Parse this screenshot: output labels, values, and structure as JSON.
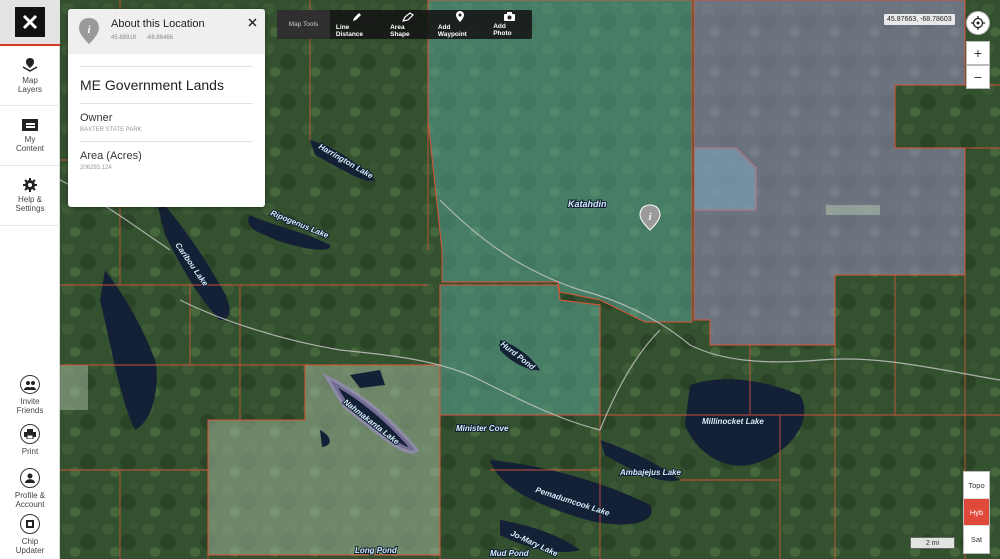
{
  "sidebar": {
    "items": [
      {
        "label": "Map\nLayers",
        "icon": "map-layers-icon"
      },
      {
        "label": "My\nContent",
        "icon": "folder-icon"
      },
      {
        "label": "Help &\nSettings",
        "icon": "gear-icon"
      }
    ],
    "bottom_items": [
      {
        "label": "Invite\nFriends",
        "icon": "invite-friends-icon"
      },
      {
        "label": "Print",
        "icon": "printer-icon"
      },
      {
        "label": "Profile &\nAccount",
        "icon": "profile-icon"
      },
      {
        "label": "Chip\nUpdater",
        "icon": "chip-icon"
      }
    ]
  },
  "info_panel": {
    "title": "About this Location",
    "lat": "45.88918",
    "lon": "-68.86466",
    "name": "ME Government Lands",
    "owner_label": "Owner",
    "owner_value": "BAXTER STATE PARK",
    "area_label": "Area (Acres)",
    "area_value": "206293.124"
  },
  "toolbar": {
    "caption": "Map Tools",
    "tools": [
      {
        "label": "Line Distance",
        "icon": "pencil-icon"
      },
      {
        "label": "Area Shape",
        "icon": "area-shape-icon"
      },
      {
        "label": "Add Waypoint",
        "icon": "waypoint-icon"
      },
      {
        "label": "Add Photo",
        "icon": "camera-icon"
      }
    ]
  },
  "coordinates": "45.87663, -68.78603",
  "zoom": {
    "in": "+",
    "out": "−"
  },
  "basemaps": [
    {
      "label": "Topo",
      "active": false
    },
    {
      "label": "Hyb",
      "active": true
    },
    {
      "label": "Sat",
      "active": false
    }
  ],
  "scale_label": "2 mi",
  "map_labels": {
    "harrington": "Harrington Lake",
    "ripogenus": "Ripogenus Lake",
    "caribou": "Caribou Lake",
    "katahdin": "Katahdin",
    "hurd": "Hurd Pond",
    "millinocket": "Millinocket Lake",
    "nahmakanta": "Nahmakanta Lake",
    "minister": "Minister Cove",
    "ambajejus": "Ambajejus Lake",
    "pemadumcook": "Pemadumcook Lake",
    "jomary": "Jo-Mary Lake",
    "longpond": "Long Pond",
    "mudpond": "Mud Pond"
  },
  "colors": {
    "accent": "#e0483a",
    "public_land": "#5fb3a8",
    "private_land": "#9b8fbf",
    "parcel_line": "#d9553a"
  }
}
